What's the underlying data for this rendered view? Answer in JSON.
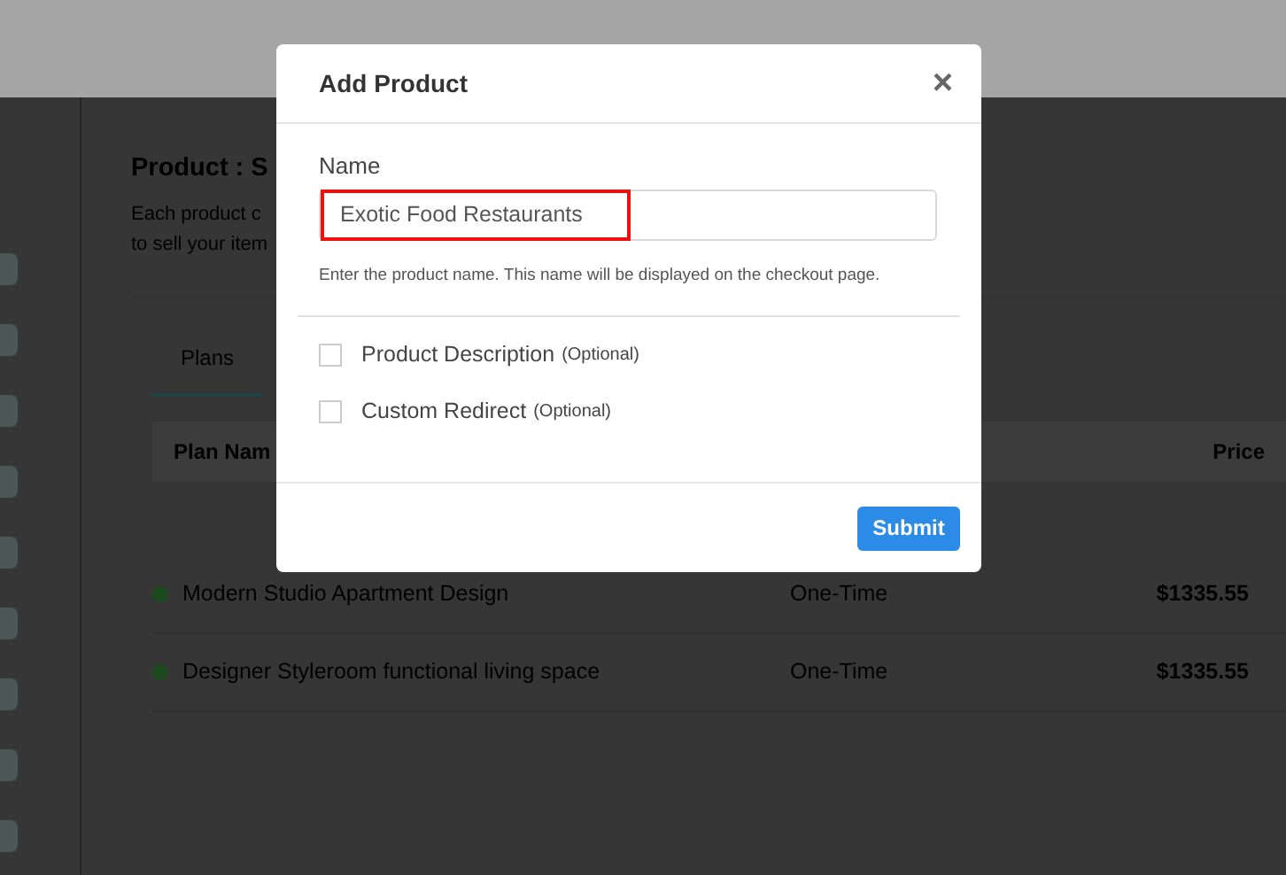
{
  "page": {
    "title": "Product : S",
    "description": [
      "Each product c",
      "to sell your item"
    ]
  },
  "tabs": [
    {
      "label": "Plans",
      "selected": true
    }
  ],
  "table": {
    "columns": [
      "Plan Nam",
      "Price"
    ],
    "rows": [
      {
        "name": "Modern Studio Apartment Design",
        "type": "One-Time",
        "price": "$1335.55",
        "color": "#1c4a1c"
      },
      {
        "name": "Designer Styleroom functional living space",
        "type": "One-Time",
        "price": "$1335.55",
        "color": "#1c4a1c"
      }
    ]
  },
  "modal": {
    "title": "Add Product",
    "close": "×",
    "field_label": "Name",
    "value": "Exotic Food Restaurants",
    "help": "Enter the product name. This name will be displayed on the checkout page.",
    "options": [
      {
        "label": "Product Description",
        "note": "(Optional)",
        "checked": false
      },
      {
        "label": "Custom Redirect",
        "note": "(Optional)",
        "checked": false
      }
    ],
    "submit": "Submit"
  }
}
